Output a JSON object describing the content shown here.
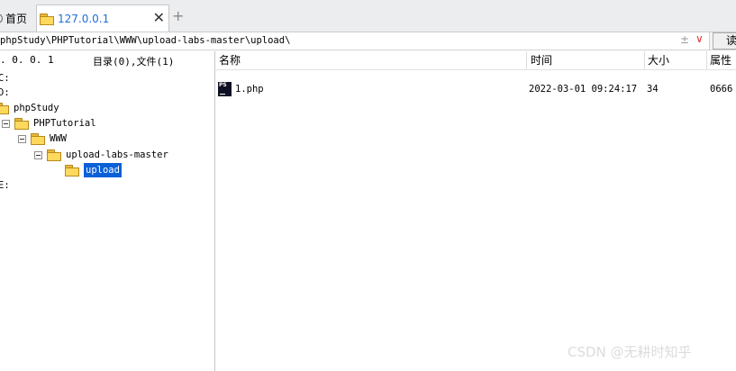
{
  "tabs": {
    "home_label": "首页",
    "active_label": "127.0.0.1",
    "close_glyph": "✕",
    "add_glyph": "+"
  },
  "address": {
    "path": "phpStudy\\PHPTutorial\\WWW\\upload-labs-master\\upload\\",
    "pm_glyph": "±",
    "chevron_glyph": "∨",
    "read_button": "读"
  },
  "left_header": {
    "ip": ". 0. 0. 1",
    "summary": "目录(0),文件(1)"
  },
  "columns": {
    "name": "名称",
    "time": "时间",
    "size": "大小",
    "attr": "属性"
  },
  "tree": [
    {
      "label": "C:"
    },
    {
      "label": "D:"
    },
    {
      "label": "phpStudy"
    },
    {
      "label": "PHPTutorial"
    },
    {
      "label": "WWW"
    },
    {
      "label": "upload-labs-master"
    },
    {
      "label": "upload"
    },
    {
      "label": "E:"
    }
  ],
  "files": [
    {
      "name": "1.php",
      "time": "2022-03-01 09:24:17",
      "size": "34",
      "attr": "0666",
      "icon": "phpstorm-file-icon",
      "icon_text": "PS"
    }
  ],
  "watermark": "CSDN @无耕时知乎"
}
